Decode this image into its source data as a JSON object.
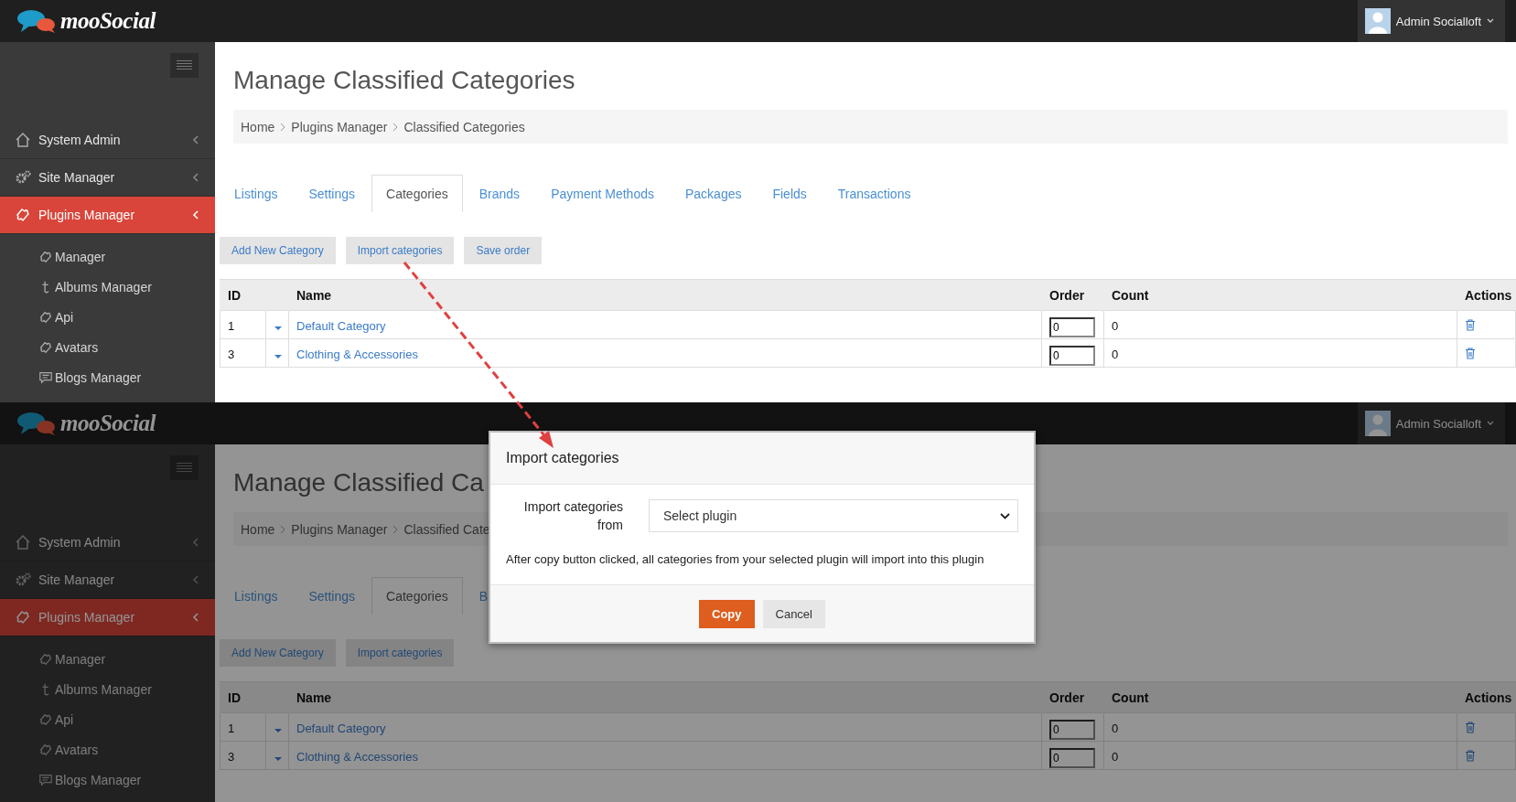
{
  "screens": [
    {
      "header": {
        "brand": "mooSocial",
        "user": "Admin Socialloft"
      },
      "sidebar": {
        "items": [
          {
            "label": "System Admin",
            "selected": false
          },
          {
            "label": "Site Manager",
            "selected": false
          },
          {
            "label": "Plugins Manager",
            "selected": true
          }
        ],
        "subitems": [
          "Manager",
          "Albums Manager",
          "Api",
          "Avatars",
          "Blogs Manager"
        ]
      },
      "page": {
        "title": "Manage Classified Categories",
        "breadcrumb": [
          "Home",
          "Plugins Manager",
          "Classified Categories"
        ],
        "tabs": [
          {
            "label": "Listings",
            "selected": false
          },
          {
            "label": "Settings",
            "selected": false
          },
          {
            "label": "Categories",
            "selected": true
          },
          {
            "label": "Brands",
            "selected": false
          },
          {
            "label": "Payment Methods",
            "selected": false
          },
          {
            "label": "Packages",
            "selected": false
          },
          {
            "label": "Fields",
            "selected": false
          },
          {
            "label": "Transactions",
            "selected": false
          }
        ],
        "buttons": [
          "Add New Category",
          "Import categories",
          "Save order"
        ],
        "table": {
          "columns": [
            "ID",
            "Name",
            "Order",
            "Count",
            "Actions"
          ],
          "rows": [
            {
              "id": "1",
              "name": "Default Category",
              "order": "0",
              "count": "0"
            },
            {
              "id": "3",
              "name": "Clothing & Accessories",
              "order": "0",
              "count": "0"
            }
          ]
        }
      }
    },
    {
      "header": {
        "brand": "mooSocial",
        "user": "Admin Socialloft"
      },
      "sidebar": {
        "items": [
          {
            "label": "System Admin",
            "selected": false
          },
          {
            "label": "Site Manager",
            "selected": false
          },
          {
            "label": "Plugins Manager",
            "selected": true
          }
        ],
        "subitems": [
          "Manager",
          "Albums Manager",
          "Api",
          "Avatars",
          "Blogs Manager"
        ]
      },
      "page": {
        "title": "Manage Classified Ca",
        "breadcrumb": [
          "Home",
          "Plugins Manager",
          "Classified Cate"
        ],
        "tabs": [
          {
            "label": "Listings",
            "selected": false
          },
          {
            "label": "Settings",
            "selected": false
          },
          {
            "label": "Categories",
            "selected": true
          },
          {
            "label": "B",
            "selected": false
          }
        ],
        "buttons": [
          "Add New Category",
          "Import categories"
        ],
        "table": {
          "columns": [
            "ID",
            "Name",
            "Order",
            "Count",
            "Actions"
          ],
          "rows": [
            {
              "id": "1",
              "name": "Default Category",
              "order": "0",
              "count": "0"
            },
            {
              "id": "3",
              "name": "Clothing & Accessories",
              "order": "0",
              "count": "0"
            }
          ]
        }
      },
      "modal": {
        "title": "Import categories",
        "label": "Import categories from",
        "select": "Select plugin",
        "note": "After copy button clicked, all categories from your selected plugin will import into this plugin",
        "buttons": [
          {
            "label": "Copy",
            "kind": "primary"
          },
          {
            "label": "Cancel",
            "kind": "default"
          }
        ]
      }
    }
  ]
}
